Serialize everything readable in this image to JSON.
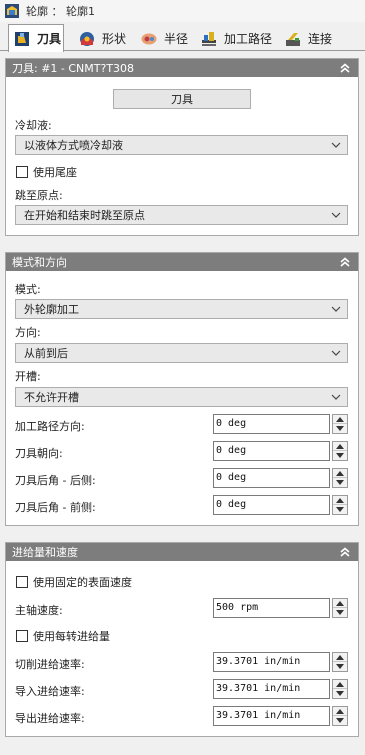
{
  "window": {
    "title": "轮廓 ： 轮廓1",
    "icon": "profile-icon"
  },
  "tabs": [
    {
      "label": "刀具",
      "icon": "tool-icon",
      "active": true
    },
    {
      "label": "形状",
      "icon": "shape-icon",
      "active": false
    },
    {
      "label": "半径",
      "icon": "radius-icon",
      "active": false
    },
    {
      "label": "加工路径",
      "icon": "toolpath-icon",
      "active": false
    },
    {
      "label": "连接",
      "icon": "link-icon",
      "active": false
    }
  ],
  "tool_panel": {
    "title": "刀具: #1 - CNMT?T308",
    "tool_button": "刀具",
    "coolant_label": "冷却液:",
    "coolant_value": "以液体方式喷冷却液",
    "tailstock_label": "使用尾座",
    "tailstock_checked": false,
    "home_label": "跳至原点:",
    "home_value": "在开始和结束时跳至原点"
  },
  "mode_panel": {
    "title": "模式和方向",
    "mode_label": "模式:",
    "mode_value": "外轮廓加工",
    "direction_label": "方向:",
    "direction_value": "从前到后",
    "grooving_label": "开槽:",
    "grooving_value": "不允许开槽",
    "fields": [
      {
        "label": "加工路径方向:",
        "value": "0 deg"
      },
      {
        "label": "刀具朝向:",
        "value": "0 deg"
      },
      {
        "label": "刀具后角 - 后侧:",
        "value": "0 deg"
      },
      {
        "label": "刀具后角 - 前侧:",
        "value": "0 deg"
      }
    ]
  },
  "feed_panel": {
    "title": "进给量和速度",
    "css_label": "使用固定的表面速度",
    "css_checked": false,
    "spindle_label": "主轴速度:",
    "spindle_value": "500 rpm",
    "fpr_label": "使用每转进给量",
    "fpr_checked": false,
    "fields": [
      {
        "label": "切削进给速率:",
        "value": "39.3701 in/min"
      },
      {
        "label": "导入进给速率:",
        "value": "39.3701 in/min"
      },
      {
        "label": "导出进给速率:",
        "value": "39.3701 in/min"
      }
    ]
  },
  "colors": {
    "panel_header": "#7d7d7d",
    "dropdown_bg": "#e9e9e9"
  }
}
